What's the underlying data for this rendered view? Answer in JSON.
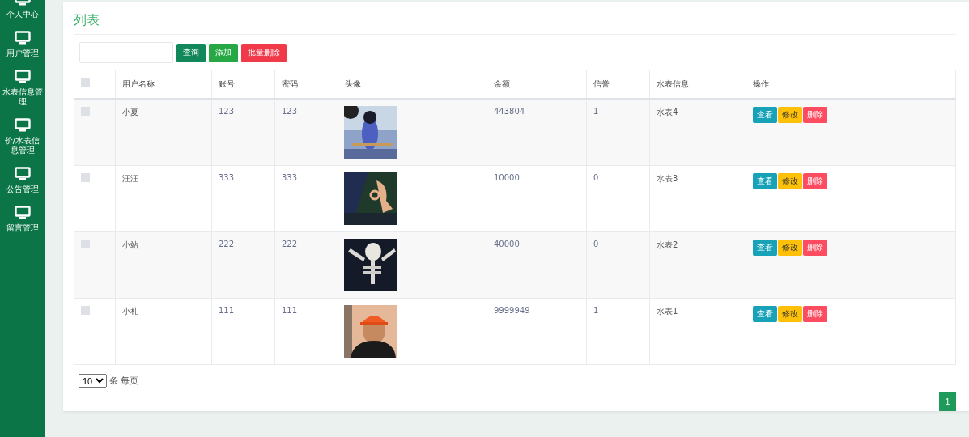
{
  "sidebar": {
    "items": [
      {
        "label": "个人中心",
        "selected": false
      },
      {
        "label": "用户管理",
        "selected": false
      },
      {
        "label": "水表信息管理",
        "selected": false
      },
      {
        "label": "价/水表信息管理",
        "selected": false
      },
      {
        "label": "公告管理",
        "selected": false
      },
      {
        "label": "留言管理",
        "selected": false
      }
    ]
  },
  "panel": {
    "title": "列表",
    "buttons": [
      {
        "label": "查询",
        "kind": "query"
      },
      {
        "label": "添加",
        "kind": "add"
      },
      {
        "label": "批量删除",
        "kind": "delete"
      }
    ],
    "table": {
      "select_all": {
        "checked": false
      },
      "columns": [
        "用户名称",
        "账号",
        "密码",
        "头像",
        "余额",
        "信誉",
        "水表信息",
        "操作"
      ],
      "rows": [
        {
          "checked": false,
          "name": "小夏",
          "account": "123",
          "password": "123",
          "balance": "443804",
          "credit": "1",
          "meter": "水表4",
          "actions": [
            {
              "label": "查看",
              "kind": "view"
            },
            {
              "label": "修改",
              "kind": "edit"
            },
            {
              "label": "删除",
              "kind": "delete"
            }
          ]
        },
        {
          "checked": false,
          "name": "汪汪",
          "account": "333",
          "password": "333",
          "balance": "10000",
          "credit": "0",
          "meter": "水表3",
          "actions": [
            {
              "label": "查看",
              "kind": "view"
            },
            {
              "label": "修改",
              "kind": "edit"
            },
            {
              "label": "删除",
              "kind": "delete"
            }
          ]
        },
        {
          "checked": false,
          "name": "小站",
          "account": "222",
          "password": "222",
          "balance": "40000",
          "credit": "0",
          "meter": "水表2",
          "actions": [
            {
              "label": "查看",
              "kind": "view"
            },
            {
              "label": "修改",
              "kind": "edit"
            },
            {
              "label": "删除",
              "kind": "delete"
            }
          ]
        },
        {
          "checked": false,
          "name": "小札",
          "account": "111",
          "password": "111",
          "balance": "9999949",
          "credit": "1",
          "meter": "水表1",
          "actions": [
            {
              "label": "查看",
              "kind": "view"
            },
            {
              "label": "修改",
              "kind": "edit"
            },
            {
              "label": "删除",
              "kind": "delete"
            }
          ]
        }
      ]
    },
    "page_size": {
      "value": "10",
      "suffix": "条 每页"
    },
    "pages": [
      {
        "label": "1",
        "selected": true
      }
    ]
  }
}
